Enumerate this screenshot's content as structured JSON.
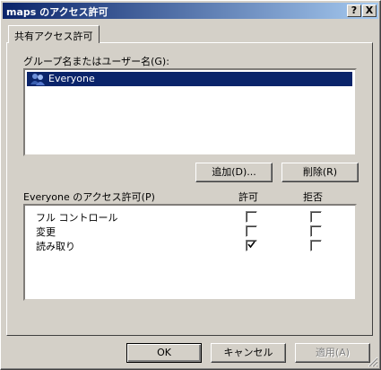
{
  "window": {
    "title": "maps のアクセス許可",
    "help_btn": "?",
    "close_btn": "X"
  },
  "tab": {
    "label": "共有アクセス許可"
  },
  "group_section": {
    "label": "グループ名またはユーザー名(G):",
    "items": [
      {
        "name": "Everyone",
        "selected": true,
        "icon": "users-group-icon"
      }
    ],
    "add_button": "追加(D)...",
    "remove_button": "削除(R)"
  },
  "permissions": {
    "header_label": "Everyone のアクセス許可(P)",
    "allow_header": "許可",
    "deny_header": "拒否",
    "rows": [
      {
        "label": "フル コントロール",
        "allow": false,
        "deny": false
      },
      {
        "label": "変更",
        "allow": false,
        "deny": false
      },
      {
        "label": "読み取り",
        "allow": true,
        "deny": false
      }
    ]
  },
  "footer": {
    "ok": "OK",
    "cancel": "キャンセル",
    "apply": "適用(A)"
  },
  "colors": {
    "title_start": "#0a246a",
    "title_end": "#a6caf0",
    "selection": "#0a246a",
    "face": "#d4d0c8"
  }
}
